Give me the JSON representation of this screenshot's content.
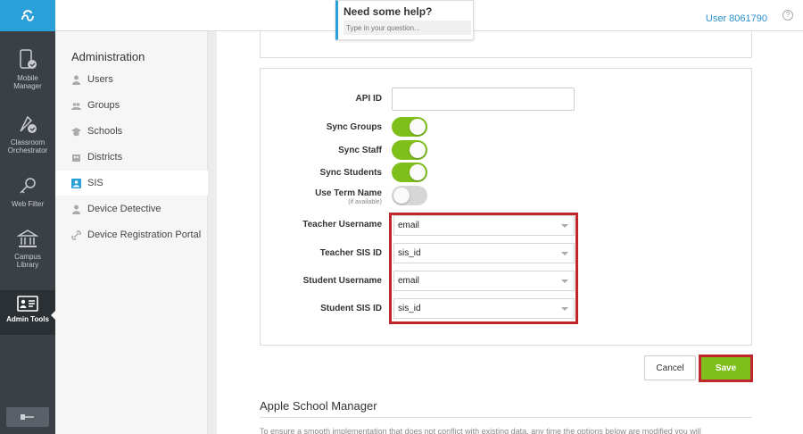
{
  "rail": {
    "items": [
      {
        "label_line1": "Mobile",
        "label_line2": "Manager",
        "icon": "mobile-manager-icon"
      },
      {
        "label_line1": "Classroom",
        "label_line2": "Orchestrator",
        "icon": "classroom-orchestrator-icon"
      },
      {
        "label_line1": "Web Filter",
        "label_line2": "",
        "icon": "key-icon"
      },
      {
        "label_line1": "Campus",
        "label_line2": "Library",
        "icon": "library-icon"
      },
      {
        "label_line1": "Admin Tools",
        "label_line2": "",
        "icon": "admin-tools-icon"
      }
    ],
    "active_index": 4
  },
  "topbar": {
    "user": "User 8061790",
    "help_icon": "?"
  },
  "help_widget": {
    "title": "Need some help?",
    "placeholder": "Type in your question..."
  },
  "admin_nav": {
    "title": "Administration",
    "items": [
      {
        "label": "Users",
        "icon": "user-icon"
      },
      {
        "label": "Groups",
        "icon": "groups-icon"
      },
      {
        "label": "Schools",
        "icon": "school-icon"
      },
      {
        "label": "Districts",
        "icon": "district-icon"
      },
      {
        "label": "SIS",
        "icon": "sis-icon"
      },
      {
        "label": "Device Detective",
        "icon": "device-detective-icon"
      },
      {
        "label": "Device Registration Portal",
        "icon": "link-icon"
      }
    ],
    "active_index": 4
  },
  "form": {
    "api_id_label": "API ID",
    "api_id_value": "",
    "sync_groups_label": "Sync Groups",
    "sync_groups_on": true,
    "sync_staff_label": "Sync Staff",
    "sync_staff_on": true,
    "sync_students_label": "Sync Students",
    "sync_students_on": true,
    "use_term_name_label": "Use Term Name",
    "use_term_name_sub": "(if available)",
    "use_term_name_on": false,
    "teacher_username_label": "Teacher Username",
    "teacher_username_value": "email",
    "teacher_sis_id_label": "Teacher SIS ID",
    "teacher_sis_id_value": "sis_id",
    "student_username_label": "Student Username",
    "student_username_value": "email",
    "student_sis_id_label": "Student SIS ID",
    "student_sis_id_value": "sis_id"
  },
  "actions": {
    "cancel": "Cancel",
    "save": "Save"
  },
  "apple_section": {
    "title": "Apple School Manager",
    "text": "To ensure a smooth implementation that does not conflict with existing data, any time the options below are modified you will"
  },
  "colors": {
    "accent": "#2a9fd8",
    "toggle_on": "#7fbf1b",
    "highlight": "#c0272d",
    "rail_bg": "#3a4046"
  }
}
